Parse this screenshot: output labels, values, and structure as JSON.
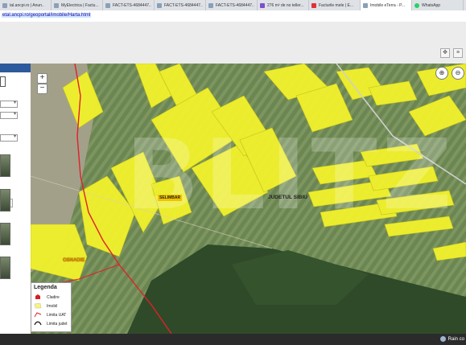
{
  "browser": {
    "tabs": [
      {
        "label": "tal.ancpi.ro | Anun.."
      },
      {
        "label": "MyElectrica | Factu..."
      },
      {
        "label": "FACT-ETS-4684447..."
      },
      {
        "label": "FACT-ETS-4684447..."
      },
      {
        "label": "FACT-ETS-4684447..."
      },
      {
        "label": "276 m² de no teller..."
      },
      {
        "label": "Facturile mele | E..."
      },
      {
        "label": "Imobile eTerra - P..."
      },
      {
        "label": "WhatsApp"
      }
    ],
    "active_tab_index": 7,
    "url": "etal.ancpi.ro/geoportal/imobile/Harta.html"
  },
  "left_panel": {
    "button_label": "ascful"
  },
  "map": {
    "zoom_in": "+",
    "zoom_out": "−",
    "labels": {
      "place1": "SELIMBAR",
      "place2": "OSNADIE",
      "county": "JUDETUL SIBIU"
    },
    "watermark": "BLITZ"
  },
  "legend": {
    "title": "Legenda",
    "items": [
      {
        "label": "Cladire"
      },
      {
        "label": "Imobil"
      },
      {
        "label": "Limita UAT"
      },
      {
        "label": "Limita judet"
      }
    ]
  },
  "taskbar": {
    "weather": "Rain co"
  },
  "colors": {
    "parcel_fill": "#f2f22c",
    "uat_border": "#e0202a",
    "forest": "#2f4a29"
  }
}
